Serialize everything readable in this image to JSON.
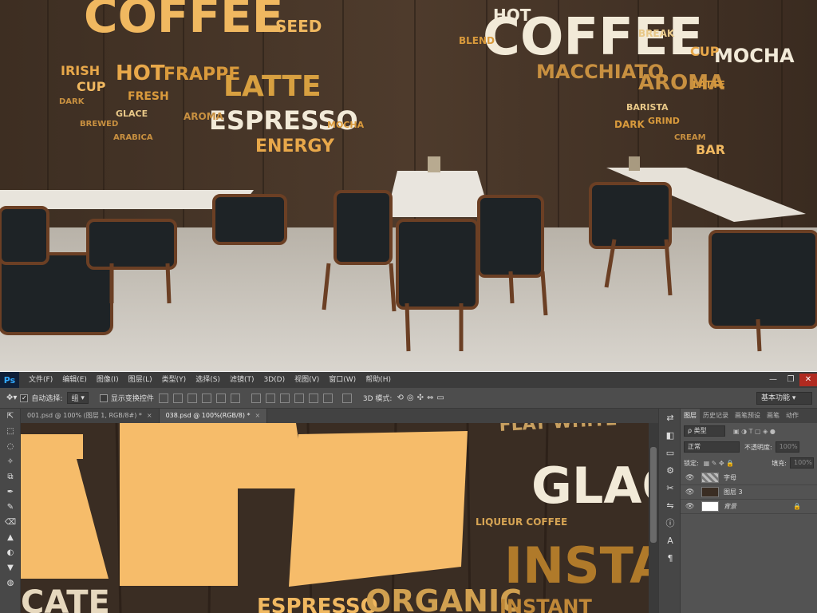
{
  "photo": {
    "wall_words_left": [
      "COFFEE",
      "HOT",
      "FRAPPE",
      "LATTE",
      "ESPRESSO",
      "ENERGY",
      "IRISH",
      "CUP",
      "FRESH",
      "GLACE",
      "SEED",
      "AROMA",
      "MOCHA",
      "BREWED",
      "DARK",
      "ARABICA"
    ],
    "wall_words_right": [
      "HOT",
      "COFFEE",
      "MOCHA",
      "MACCHIATO",
      "AROMA",
      "CUP",
      "BAR",
      "BLEND",
      "BARISTA",
      "GRIND",
      "DARK",
      "LATTE",
      "BREAK",
      "CREAM"
    ]
  },
  "app": {
    "logo": "Ps",
    "menu": [
      "文件(F)",
      "编辑(E)",
      "图像(I)",
      "图层(L)",
      "类型(Y)",
      "选择(S)",
      "滤镜(T)",
      "3D(D)",
      "视图(V)",
      "窗口(W)",
      "帮助(H)"
    ],
    "window_buttons": [
      "—",
      "❐",
      "✕"
    ]
  },
  "options": {
    "auto_select_label": "自动选择:",
    "auto_select_value": "组",
    "show_transform_label": "显示变换控件",
    "mode_3d_label": "3D 模式:",
    "workspace": "基本功能"
  },
  "tools": [
    "⇱",
    "⬚",
    "◌",
    "✧",
    "⧉",
    "✒",
    "✎",
    "⌫",
    "▲",
    "◐",
    "▼",
    "◍"
  ],
  "tabs": [
    {
      "label": "001.psd @ 100% (图层 1, RGB/8#) *",
      "close": "×"
    },
    {
      "label": "038.psd @ 100%(RGB/8) *",
      "close": "×"
    }
  ],
  "canvas": {
    "words": [
      "FLAT WHITE",
      "GLAC",
      "LIQUEUR COFFEE",
      "INSTAI",
      "ESPRESSO",
      "ORGANIC",
      "INSTANT",
      "CATE"
    ]
  },
  "panel": {
    "tabs": [
      "图层",
      "历史记录",
      "画笔预设",
      "画笔",
      "动作"
    ],
    "kind_label": "ρ 类型",
    "blend_mode": "正常",
    "opacity_label": "不透明度:",
    "opacity_value": "100%",
    "lock_label": "锁定:",
    "fill_label": "填充:",
    "fill_value": "100%",
    "layers": [
      {
        "name": "字母",
        "eye": "👁",
        "lock": ""
      },
      {
        "name": "图层 3",
        "eye": "👁",
        "lock": ""
      },
      {
        "name": "背景",
        "eye": "👁",
        "lock": "🔒"
      }
    ]
  },
  "strip_icons": [
    "⇄",
    "◧",
    "▭",
    "⚙",
    "✂",
    "⇋",
    "ⓘ",
    "A",
    "¶"
  ]
}
